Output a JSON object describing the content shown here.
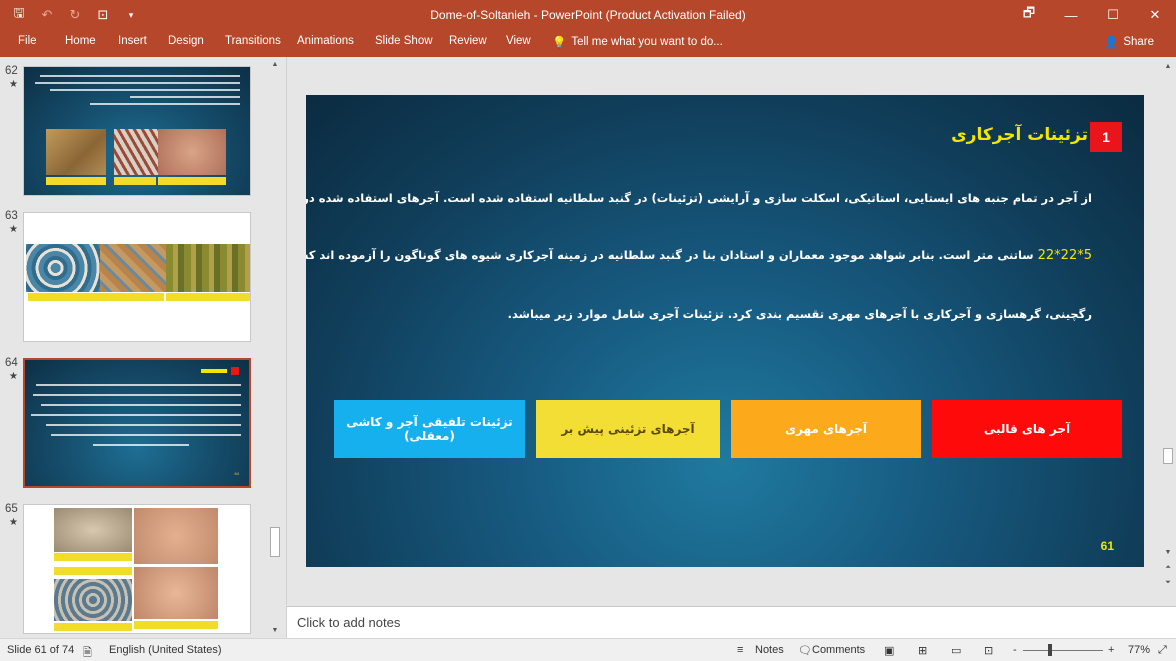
{
  "window": {
    "title": "Dome-of-Soltanieh - PowerPoint (Product Activation Failed)",
    "controls": [
      "🗗",
      "—",
      "☐",
      "✕"
    ]
  },
  "qat": {
    "save_icon": "🖫",
    "undo_icon": "↶",
    "redo_icon": "↻",
    "present_icon": "⊡",
    "more_icon": "▾"
  },
  "ribbon": {
    "tabs": [
      "File",
      "Home",
      "Insert",
      "Design",
      "Transitions",
      "Animations",
      "Slide Show",
      "Review",
      "View"
    ],
    "tell_me": "Tell me what you want to do...",
    "share": "Share"
  },
  "thumbnails": [
    {
      "number": "62",
      "star": "★"
    },
    {
      "number": "63",
      "star": "★"
    },
    {
      "number": "64",
      "star": "★"
    },
    {
      "number": "65",
      "star": "★"
    }
  ],
  "slide": {
    "title": "تزئینات آجرکاری",
    "title_number": "1",
    "paragraph_lines": [
      "از آجر در تمام جنبه های ایستایی، استاتیکی، اسکلت سازی و آرایشی (تزئینات) در گنبد سلطانیه استفاده شده است. آجرهای استفاده شده در اسکلت بنا در ابعاد",
      "ساتنی متر است. بنابر شواهد موجود معماران و استادان بنا در گنبد سلطانیه در زمینه آجرکاری شیوه های گوناگون را آزموده اند که میتوان آنها را به",
      "رگچینی، گرهسازی و آجرکاری با آجرهای مهری تقسیم بندی کرد. تزئینات آجری شامل موارد زیر میباشد."
    ],
    "highlight_dimension": "5*22*22",
    "boxes": [
      {
        "label": "آجر های قالبی",
        "color": "#fe0a0a",
        "text_color": "#ffffff"
      },
      {
        "label": "آجرهای مهری",
        "color": "#fca91c",
        "text_color": "#ffffff"
      },
      {
        "label": "آجرهای تزئینی پیش بر",
        "color": "#f3de36",
        "text_color": "#5a4a00"
      },
      {
        "label": "تزئینات تلفیقی آجر و کاشی (معقلی)",
        "color": "#17b0ef",
        "text_color": "#ffffff"
      }
    ],
    "slide_number": "61"
  },
  "notes": {
    "placeholder": "Click to add notes"
  },
  "status": {
    "slide_info": "Slide 61 of 74",
    "language": "English (United States)",
    "notes_label": "Notes",
    "comments_label": "Comments",
    "zoom": "77%",
    "zoom_minus": "-",
    "zoom_plus": "+"
  }
}
